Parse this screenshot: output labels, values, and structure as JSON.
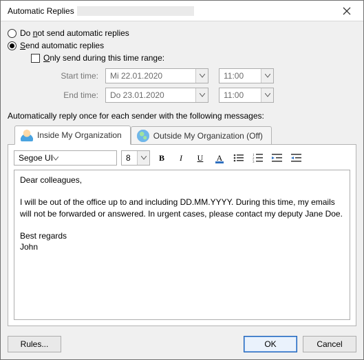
{
  "window": {
    "title": "Automatic Replies"
  },
  "options": {
    "dont_send": {
      "label_pre": "Do ",
      "label_u": "n",
      "label_post": "ot send automatic replies"
    },
    "send": {
      "label_pre": "",
      "label_u": "S",
      "label_post": "end automatic replies"
    },
    "only_range": {
      "label_pre": "",
      "label_u": "O",
      "label_post": "nly send during this time range:"
    }
  },
  "time": {
    "start_label": "Start time:",
    "start_date": "Mi 22.01.2020",
    "start_time": "11:00",
    "end_label": "End time:",
    "end_date": "Do 23.01.2020",
    "end_time": "11:00"
  },
  "section_label": "Automatically reply once for each sender with the following messages:",
  "tabs": {
    "inside": "Inside My Organization",
    "outside": "Outside My Organization (Off)"
  },
  "toolbar": {
    "font": "Segoe UI",
    "size": "8",
    "bold": "B",
    "italic": "I",
    "underline": "U",
    "fontcolor_letter": "A"
  },
  "message_body": "Dear colleagues,\n\nI will be out of the office up to and including DD.MM.YYYY. During this time, my emails will not be forwarded or answered. In urgent cases, please contact my deputy Jane Doe.\n\nBest regards\nJohn",
  "footer": {
    "rules": "Rules...",
    "ok": "OK",
    "cancel": "Cancel"
  }
}
